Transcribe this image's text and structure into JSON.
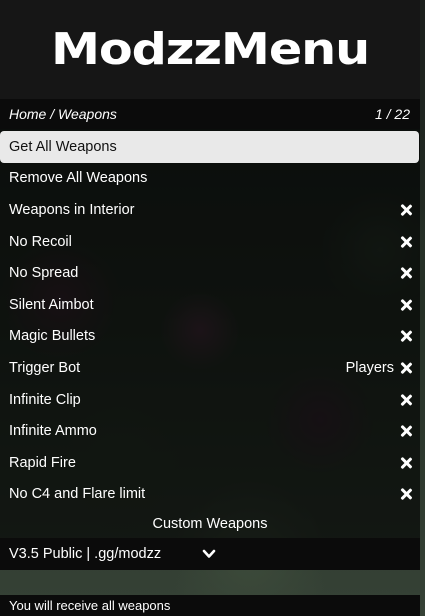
{
  "header": {
    "logo_text": "ModzzMenu"
  },
  "subheader": {
    "breadcrumb": "Home / Weapons",
    "page_counter": "1 / 22"
  },
  "items": [
    {
      "label": "Get All Weapons",
      "value": "",
      "toggle": false,
      "selected": true
    },
    {
      "label": "Remove All Weapons",
      "value": "",
      "toggle": false
    },
    {
      "label": "Weapons in Interior",
      "value": "",
      "toggle": true
    },
    {
      "label": "No Recoil",
      "value": "",
      "toggle": true
    },
    {
      "label": "No Spread",
      "value": "",
      "toggle": true
    },
    {
      "label": "Silent Aimbot",
      "value": "",
      "toggle": true
    },
    {
      "label": "Magic Bullets",
      "value": "",
      "toggle": true
    },
    {
      "label": "Trigger Bot",
      "value": "Players",
      "toggle": true
    },
    {
      "label": "Infinite Clip",
      "value": "",
      "toggle": true
    },
    {
      "label": "Infinite Ammo",
      "value": "",
      "toggle": true
    },
    {
      "label": "Rapid Fire",
      "value": "",
      "toggle": true
    },
    {
      "label": "No C4 and Flare limit",
      "value": "",
      "toggle": true
    }
  ],
  "custom_weapons_label": "Custom Weapons",
  "footer": {
    "version_text": "V3.5 Public | .gg/modzz",
    "chevron_icon": "chevron-down-icon"
  },
  "description": "You will receive all weapons",
  "colors": {
    "header_bg": "#161616",
    "bar_bg": "#0b0b0b",
    "selected_bg": "#e9e9e9"
  }
}
